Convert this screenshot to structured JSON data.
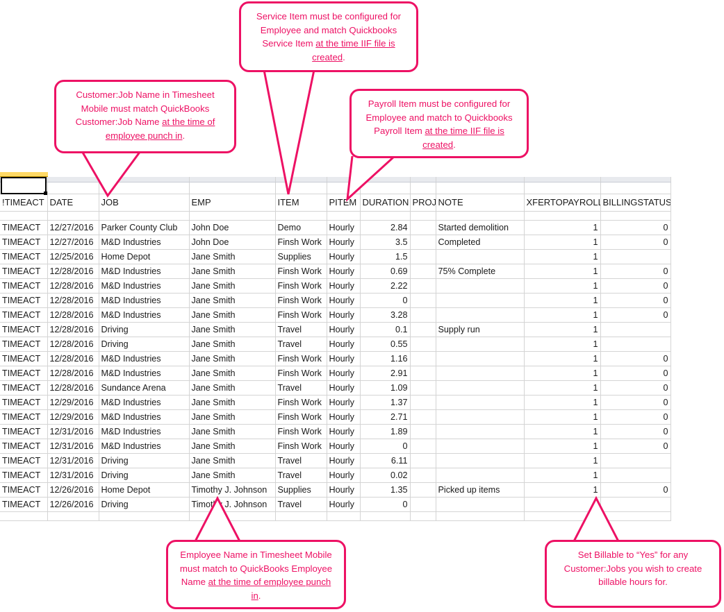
{
  "accent_color": "#ed1164",
  "sheet": {
    "selected_cell_value": "",
    "columns": [
      "!TIMEACT",
      "DATE",
      "JOB",
      "EMP",
      "ITEM",
      "PITEM",
      "DURATION",
      "PROJ",
      "NOTE",
      "XFERTOPAYROLL",
      "BILLINGSTATUS"
    ],
    "rows": [
      [
        "TIMEACT",
        "12/27/2016",
        "Parker County Club",
        "John Doe",
        "Demo",
        "Hourly",
        "2.84",
        "",
        "Started demolition",
        "1",
        "0"
      ],
      [
        "TIMEACT",
        "12/27/2016",
        "M&D Industries",
        "John Doe",
        "Finsh Work",
        "Hourly",
        "3.5",
        "",
        "Completed",
        "1",
        "0"
      ],
      [
        "TIMEACT",
        "12/25/2016",
        "Home Depot",
        "Jane Smith",
        "Supplies",
        "Hourly",
        "1.5",
        "",
        "",
        "1",
        ""
      ],
      [
        "TIMEACT",
        "12/28/2016",
        "M&D Industries",
        "Jane Smith",
        "Finsh Work",
        "Hourly",
        "0.69",
        "",
        "75% Complete",
        "1",
        "0"
      ],
      [
        "TIMEACT",
        "12/28/2016",
        "M&D Industries",
        "Jane Smith",
        "Finsh Work",
        "Hourly",
        "2.22",
        "",
        "",
        "1",
        "0"
      ],
      [
        "TIMEACT",
        "12/28/2016",
        "M&D Industries",
        "Jane Smith",
        "Finsh Work",
        "Hourly",
        "0",
        "",
        "",
        "1",
        "0"
      ],
      [
        "TIMEACT",
        "12/28/2016",
        "M&D Industries",
        "Jane Smith",
        "Finsh Work",
        "Hourly",
        "3.28",
        "",
        "",
        "1",
        "0"
      ],
      [
        "TIMEACT",
        "12/28/2016",
        "Driving",
        "Jane Smith",
        "Travel",
        "Hourly",
        "0.1",
        "",
        "Supply run",
        "1",
        ""
      ],
      [
        "TIMEACT",
        "12/28/2016",
        "Driving",
        "Jane Smith",
        "Travel",
        "Hourly",
        "0.55",
        "",
        "",
        "1",
        ""
      ],
      [
        "TIMEACT",
        "12/28/2016",
        "M&D Industries",
        "Jane Smith",
        "Finsh Work",
        "Hourly",
        "1.16",
        "",
        "",
        "1",
        "0"
      ],
      [
        "TIMEACT",
        "12/28/2016",
        "M&D Industries",
        "Jane Smith",
        "Finsh Work",
        "Hourly",
        "2.91",
        "",
        "",
        "1",
        "0"
      ],
      [
        "TIMEACT",
        "12/28/2016",
        "Sundance Arena",
        "Jane Smith",
        "Travel",
        "Hourly",
        "1.09",
        "",
        "",
        "1",
        "0"
      ],
      [
        "TIMEACT",
        "12/29/2016",
        "M&D Industries",
        "Jane Smith",
        "Finsh Work",
        "Hourly",
        "1.37",
        "",
        "",
        "1",
        "0"
      ],
      [
        "TIMEACT",
        "12/29/2016",
        "M&D Industries",
        "Jane Smith",
        "Finsh Work",
        "Hourly",
        "2.71",
        "",
        "",
        "1",
        "0"
      ],
      [
        "TIMEACT",
        "12/31/2016",
        "M&D Industries",
        "Jane Smith",
        "Finsh Work",
        "Hourly",
        "1.89",
        "",
        "",
        "1",
        "0"
      ],
      [
        "TIMEACT",
        "12/31/2016",
        "M&D Industries",
        "Jane Smith",
        "Finsh Work",
        "Hourly",
        "0",
        "",
        "",
        "1",
        "0"
      ],
      [
        "TIMEACT",
        "12/31/2016",
        "Driving",
        "Jane Smith",
        "Travel",
        "Hourly",
        "6.11",
        "",
        "",
        "1",
        ""
      ],
      [
        "TIMEACT",
        "12/31/2016",
        "Driving",
        "Jane Smith",
        "Travel",
        "Hourly",
        "0.02",
        "",
        "",
        "1",
        ""
      ],
      [
        "TIMEACT",
        "12/26/2016",
        "Home Depot",
        "Timothy J. Johnson",
        "Supplies",
        "Hourly",
        "1.35",
        "",
        "Picked up items",
        "1",
        "0"
      ],
      [
        "TIMEACT",
        "12/26/2016",
        "Driving",
        "Timothy J. Johnson",
        "Travel",
        "Hourly",
        "0",
        "",
        "",
        "1",
        ""
      ]
    ],
    "numeric_columns": [
      6,
      9,
      10
    ]
  },
  "callouts": {
    "service_item": {
      "plain_1": "Service Item must be configured for Employee and match Quickbooks Service Item ",
      "underlined": "at the time IIF file is created",
      "plain_2": "."
    },
    "customer_job": {
      "plain_1": "Customer:Job Name in Timesheet Mobile must match QuickBooks Customer:Job Name ",
      "underlined": "at the time of employee punch in",
      "plain_2": "."
    },
    "payroll_item": {
      "plain_1": "Payroll Item must be configured for Employee and match to Quickbooks Payroll Item ",
      "underlined": "at the time IIF file is created",
      "plain_2": "."
    },
    "employee_name": {
      "plain_1": "Employee Name in Timesheet Mobile must match to QuickBooks Employee Name ",
      "underlined": "at the time of employee punch in",
      "plain_2": "."
    },
    "billable": {
      "plain_1": "Set Billable to “Yes” for any Customer:Jobs you wish to create billable hours for.",
      "underlined": "",
      "plain_2": ""
    }
  }
}
